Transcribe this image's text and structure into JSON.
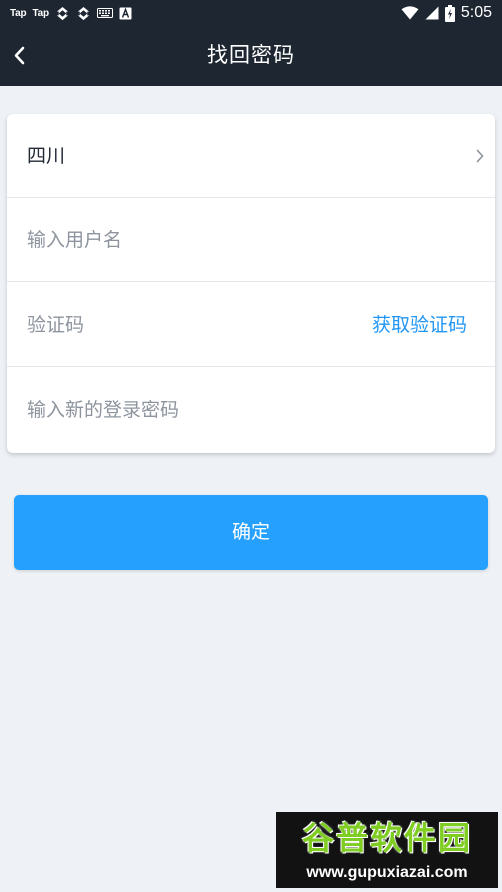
{
  "status_bar": {
    "tap_label_1": "Tap",
    "tap_label_2": "Tap",
    "time": "5:05",
    "battery_text": "B"
  },
  "header": {
    "title": "找回密码"
  },
  "form": {
    "region_value": "四川",
    "username_placeholder": "输入用户名",
    "code_placeholder": "验证码",
    "get_code_label": "获取验证码",
    "new_password_placeholder": "输入新的登录密码"
  },
  "confirm_label": "确定",
  "watermark": {
    "brand": "谷普软件园",
    "url": "www.gupuxiazai.com"
  },
  "colors": {
    "header_bg": "#1e2632",
    "page_bg": "#eef1f6",
    "accent": "#25a0ff",
    "link": "#2196f3"
  }
}
